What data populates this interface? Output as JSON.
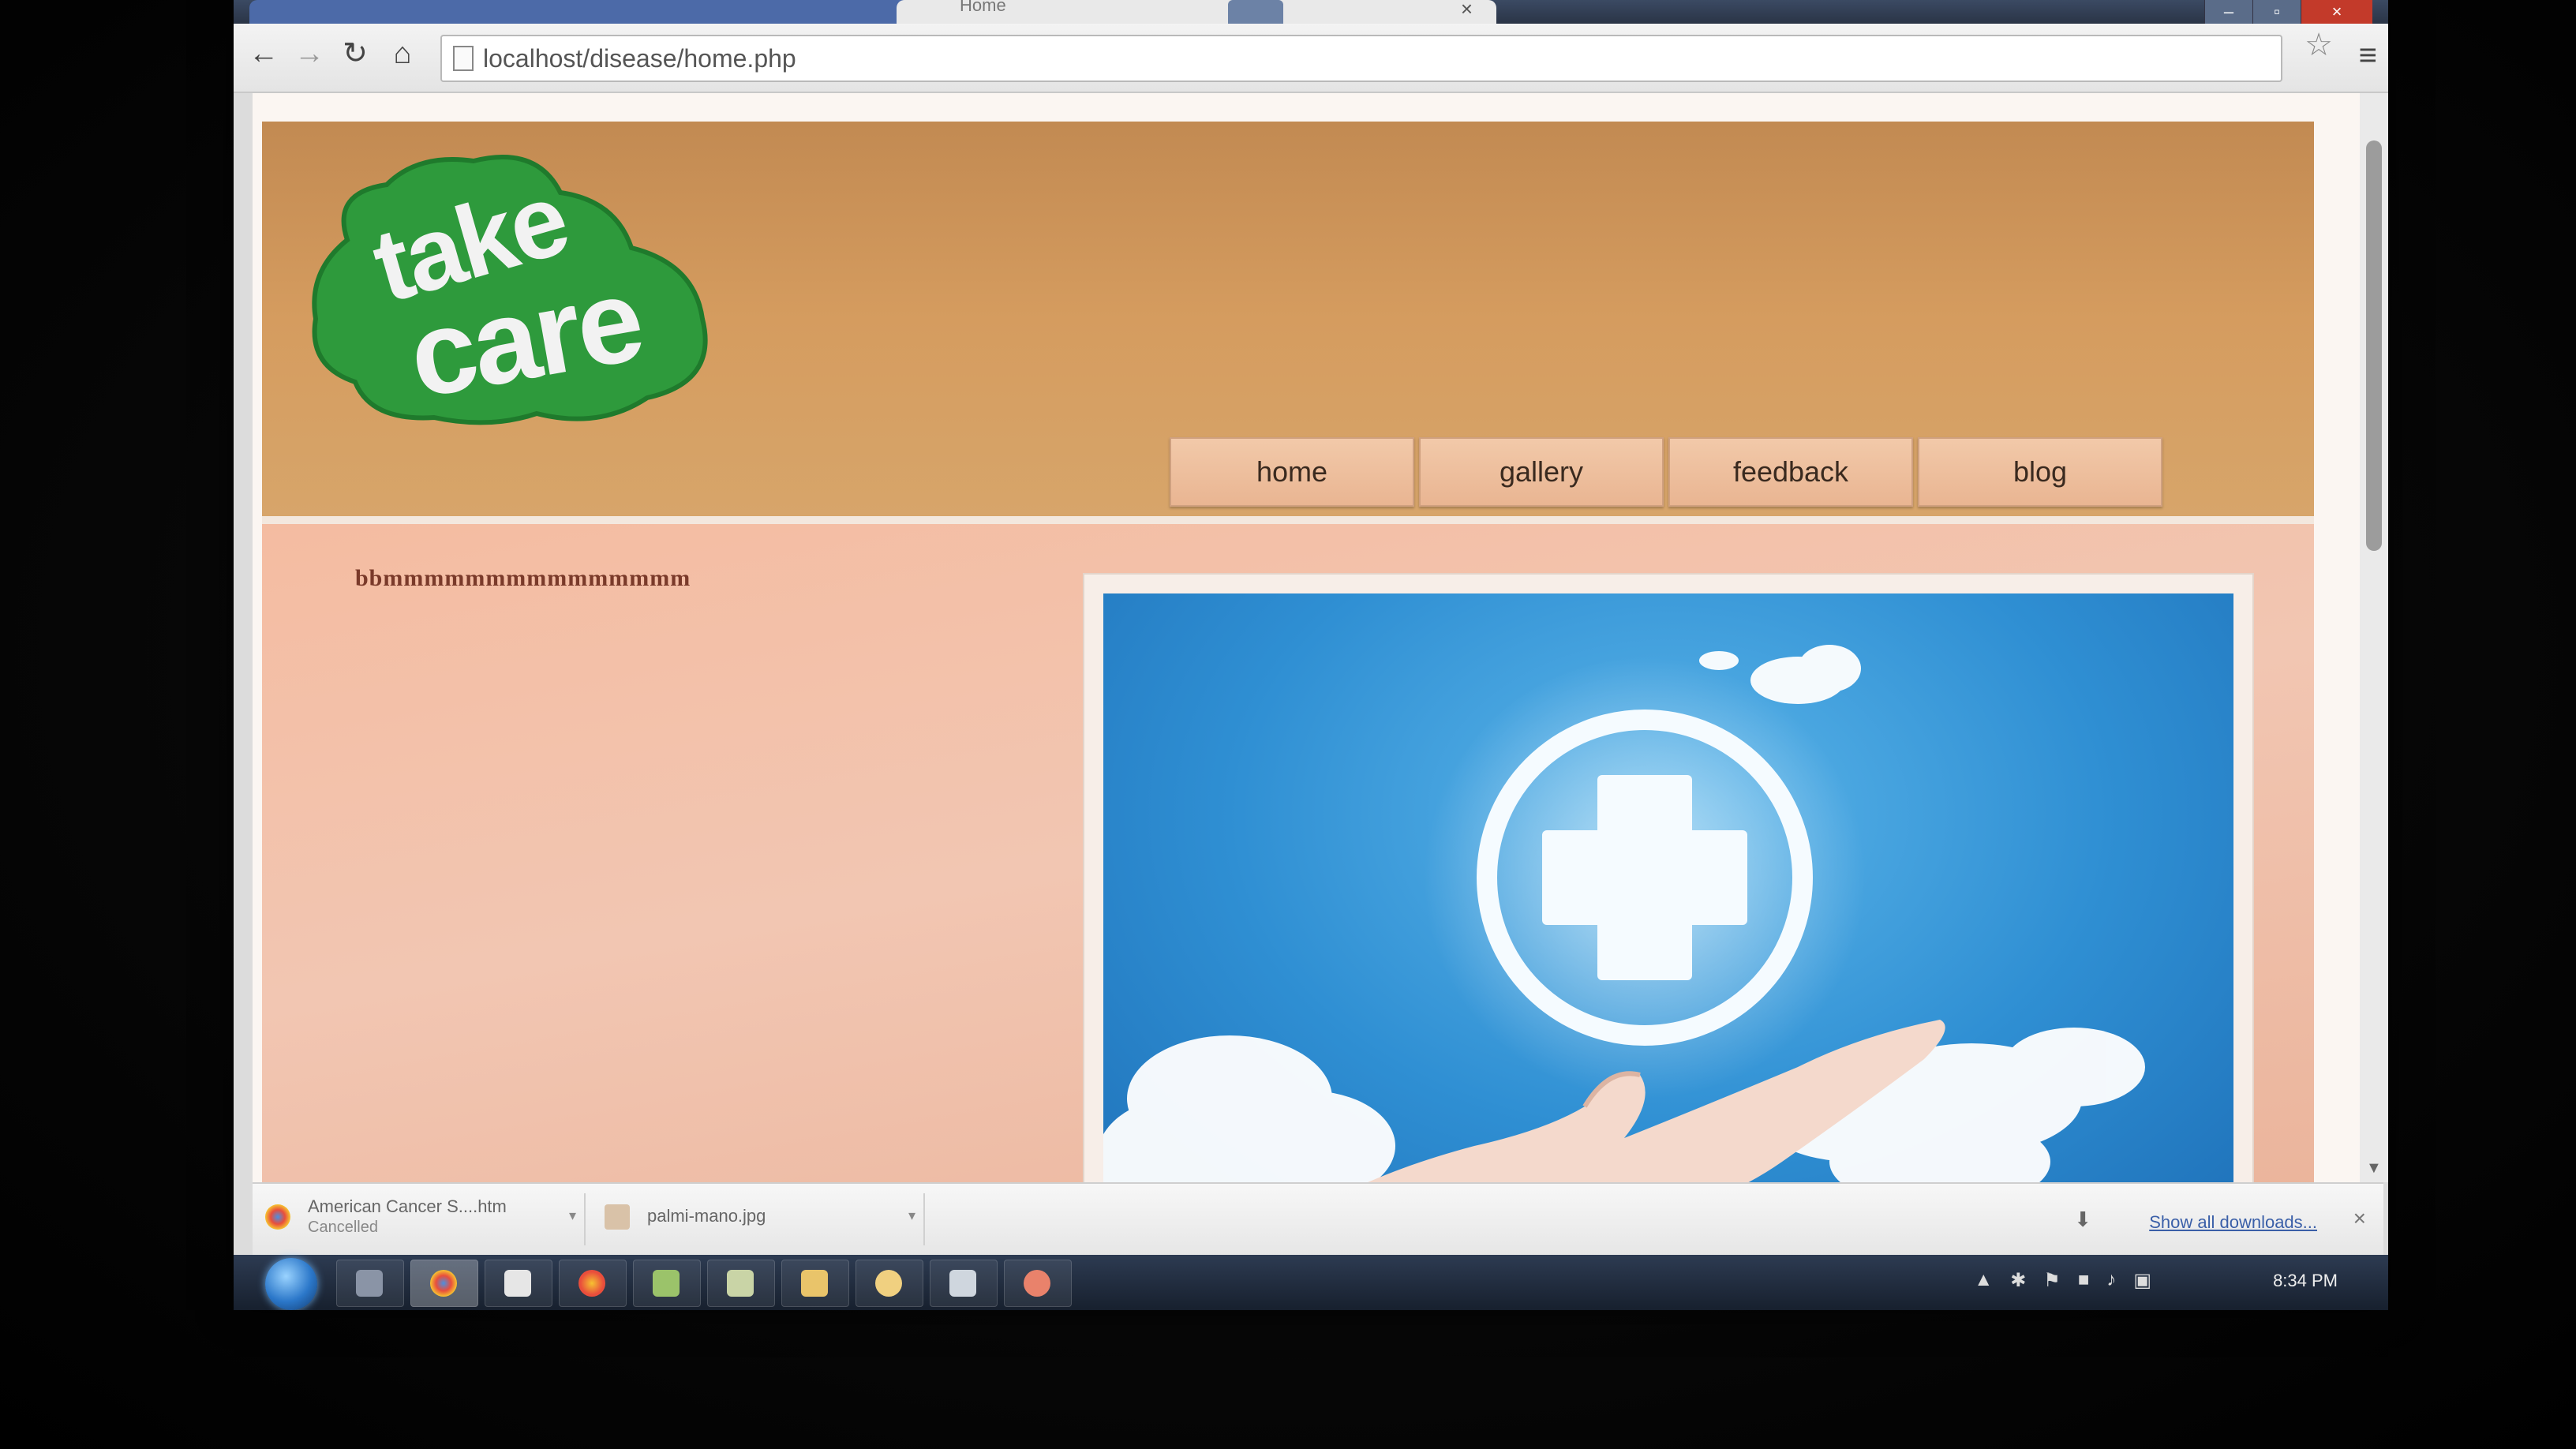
{
  "browser": {
    "active_tab_title": "Home",
    "tab_close": "×",
    "window_controls": [
      "–",
      "▫",
      "×"
    ],
    "url": "localhost/disease/home.php"
  },
  "site": {
    "logo_text": [
      "take",
      "care"
    ],
    "nav": [
      "home",
      "gallery",
      "feedback",
      "blog"
    ],
    "intro_text": "bbmmmmmmmmmmmmmmm"
  },
  "downloads": {
    "items": [
      {
        "name": "American Cancer S....htm",
        "status": "Cancelled"
      },
      {
        "name": "palmi-mano.jpg",
        "status": ""
      }
    ],
    "show_all": "Show all downloads...",
    "close": "×"
  },
  "taskbar": {
    "clock": "8:34 PM"
  },
  "colors": {
    "header": "#d59c5f",
    "content": "#f2c6b2",
    "logo_green": "#2e9a3c",
    "nav_button": "#f2c9a9"
  }
}
